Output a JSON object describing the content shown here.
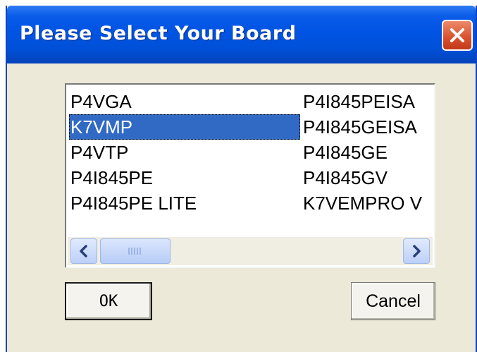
{
  "window": {
    "title": "Please Select Your Board"
  },
  "board_list": {
    "left_column": [
      "P4VGA",
      "K7VMP",
      "P4VTP",
      "P4I845PE",
      "P4I845PE LITE"
    ],
    "right_column": [
      "P4I845PEISA",
      "P4I845GEISA",
      "P4I845GE",
      "P4I845GV",
      "K7VEMPRO V"
    ],
    "selected": "K7VMP"
  },
  "buttons": {
    "ok_label": "OK",
    "cancel_label": "Cancel"
  },
  "colors": {
    "titlebar": "#0054e3",
    "selection": "#316ac5",
    "close_button": "#d9502c",
    "dialog_face": "#ece9d8"
  },
  "icons": {
    "close": "close-icon",
    "scroll_left": "chevron-left-icon",
    "scroll_right": "chevron-right-icon",
    "scroll_grip": "grip-icon"
  }
}
